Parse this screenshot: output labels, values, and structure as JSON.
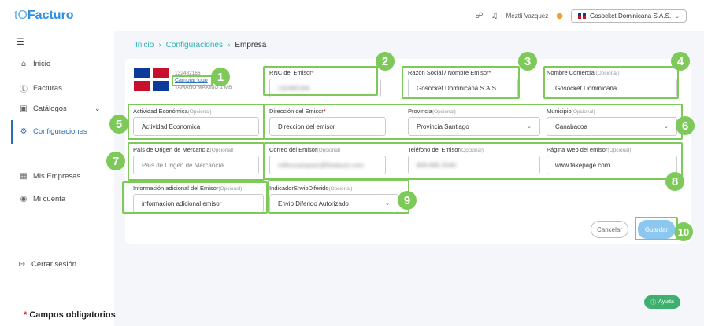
{
  "app": {
    "logo_prefix": "tO",
    "logo_name": "Facturo"
  },
  "header": {
    "user_name": "Meztli Vazquez",
    "company": "Gosocket Dominicana S.A.S."
  },
  "sidebar": {
    "items": [
      {
        "label": "Inicio",
        "icon": "home-icon"
      },
      {
        "label": "Facturas",
        "icon": "dollar-icon"
      },
      {
        "label": "Catálogos",
        "icon": "catalog-icon"
      },
      {
        "label": "Configuraciones",
        "icon": "gear-icon"
      },
      {
        "label": "Mis Empresas",
        "icon": "building-icon"
      },
      {
        "label": "Mi cuenta",
        "icon": "account-icon"
      },
      {
        "label": "Cerrar sesión",
        "icon": "logout-icon"
      }
    ]
  },
  "breadcrumb": [
    "Inicio",
    "Configuraciones",
    "Empresa"
  ],
  "logo_block": {
    "code": "132482166",
    "change_logo": "Cambiar logo",
    "size_hint": "TAMAÑO MÁXIMO 1 MB"
  },
  "form": {
    "rnc": {
      "label": "RNC del Emisor",
      "value": "132482166"
    },
    "razon": {
      "label": "Razón Social / Nombre Emisor",
      "value": "Gosocket Dominicana S.A.S."
    },
    "nombre_comercial": {
      "label": "Nombre Comercial",
      "optional": "(Opcional)",
      "value": "Gosocket Dominicana"
    },
    "actividad": {
      "label": "Actividad Económica",
      "optional": "(Opcional)",
      "value": "Actividad Economica"
    },
    "direccion": {
      "label": "Dirección del Emisor",
      "value": "Direccion del emisor"
    },
    "provincia": {
      "label": "Provincia",
      "optional": "(Opcional)",
      "value": "Provincia Santiago"
    },
    "municipio": {
      "label": "Municipio",
      "optional": "(Opcional)",
      "value": "Canabacoa"
    },
    "pais": {
      "label": "País de Origen de Mercancía",
      "optional": "(Opcional)",
      "placeholder": "País de Origen de Mercancía"
    },
    "correo": {
      "label": "Correo del Emisor",
      "optional": "(Opcional)",
      "value": "mlthuruazquez@flowbuzz.com"
    },
    "telefono": {
      "label": "Teléfono del Emisor",
      "optional": "(Opcional)",
      "value": "809-895-2540"
    },
    "web": {
      "label": "Página Web del emisor",
      "optional": "(Opcional)",
      "value": "www.fakepage.com"
    },
    "info": {
      "label": "Información adicional del Emisor",
      "optional": "(Opcional)",
      "value": "informacion adicional emisor"
    },
    "envio": {
      "label": "IndicadorEnvioDiferido",
      "optional": "(Opcional)",
      "value": "Envio Diferido Autorizado"
    }
  },
  "buttons": {
    "cancel": "Cancelar",
    "save": "Guardar",
    "help": "Ayuda"
  },
  "badges": [
    "1",
    "2",
    "3",
    "4",
    "5",
    "6",
    "7",
    "8",
    "9",
    "10"
  ],
  "note": {
    "star": "*",
    "text": " Campos obligatorios"
  },
  "colors": {
    "accent": "#7dc95a",
    "brand": "#2f8fe0",
    "save": "#8cc7ef",
    "help": "#3db06e"
  }
}
